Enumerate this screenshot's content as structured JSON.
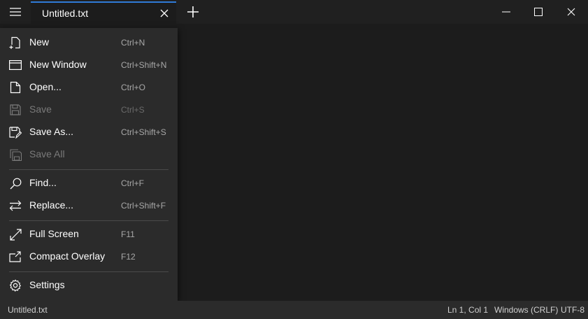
{
  "tab": {
    "title": "Untitled.txt"
  },
  "accent_color": "#2f7ad8",
  "menu": {
    "items": [
      {
        "label": "New",
        "shortcut": "Ctrl+N",
        "icon": "new-file-icon",
        "disabled": false
      },
      {
        "label": "New Window",
        "shortcut": "Ctrl+Shift+N",
        "icon": "new-window-icon",
        "disabled": false
      },
      {
        "label": "Open...",
        "shortcut": "Ctrl+O",
        "icon": "open-file-icon",
        "disabled": false
      },
      {
        "label": "Save",
        "shortcut": "Ctrl+S",
        "icon": "save-icon",
        "disabled": true
      },
      {
        "label": "Save As...",
        "shortcut": "Ctrl+Shift+S",
        "icon": "save-as-icon",
        "disabled": false
      },
      {
        "label": "Save All",
        "shortcut": "",
        "icon": "save-all-icon",
        "disabled": true
      },
      {
        "label": "Find...",
        "shortcut": "Ctrl+F",
        "icon": "search-icon",
        "disabled": false
      },
      {
        "label": "Replace...",
        "shortcut": "Ctrl+Shift+F",
        "icon": "replace-icon",
        "disabled": false
      },
      {
        "label": "Full Screen",
        "shortcut": "F11",
        "icon": "full-screen-icon",
        "disabled": false
      },
      {
        "label": "Compact Overlay",
        "shortcut": "F12",
        "icon": "compact-overlay-icon",
        "disabled": false
      },
      {
        "label": "Settings",
        "shortcut": "",
        "icon": "gear-icon",
        "disabled": false
      }
    ]
  },
  "status": {
    "file": "Untitled.txt",
    "position": "Ln 1, Col 1",
    "line_ending": "Windows (CRLF)",
    "encoding": "UTF-8"
  }
}
